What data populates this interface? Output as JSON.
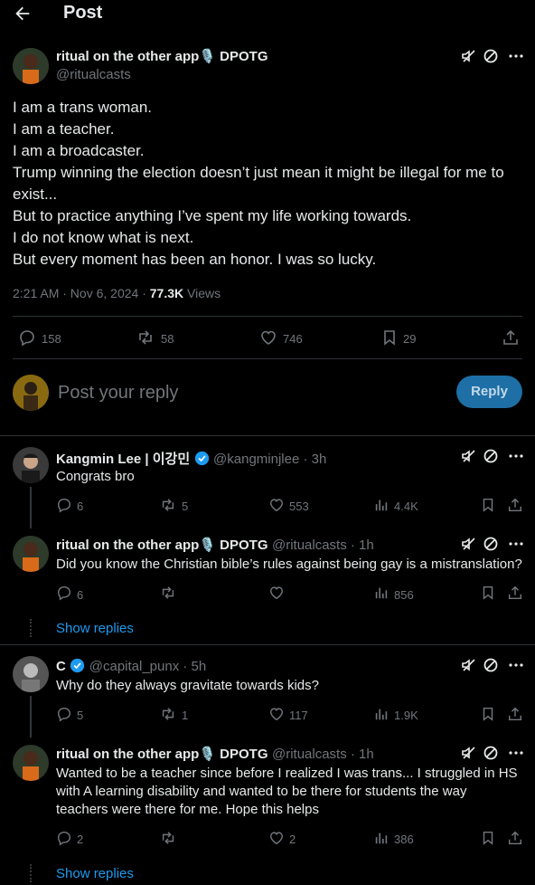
{
  "header": {
    "title": "Post"
  },
  "main_post": {
    "display_name": "ritual on the other app🎙️ DPOTG",
    "handle": "@ritualcasts",
    "lines": [
      "I am a trans woman.",
      "I am a teacher.",
      "I am a broadcaster.",
      "Trump winning the election doesn’t just mean it might be illegal for me to exist...",
      "But to practice anything I’ve spent my life working towards.",
      "I do not know what is next.",
      "But every moment has been an honor. I was so lucky."
    ],
    "timestamp": "2:21 AM · Nov 6, 2024 · ",
    "views_count": "77.3K",
    "views_label": " Views",
    "stats": {
      "replies": "158",
      "reposts": "58",
      "likes": "746",
      "bookmarks": "29"
    }
  },
  "compose": {
    "placeholder": "Post your reply",
    "reply_label": "Reply"
  },
  "replies": [
    {
      "display_name": "Kangmin Lee | 이강민",
      "handle": "@kangminjlee · 3h",
      "text": "Congrats bro",
      "stats": {
        "replies": "6",
        "reposts": "5",
        "likes": "553",
        "views": "4.4K"
      }
    },
    {
      "display_name": "ritual on the other app🎙️ DPOTG",
      "handle": "@ritualcasts · 1h",
      "text": "Did you know the Christian bible’s rules against being gay  is a mistranslation?",
      "stats": {
        "replies": "6",
        "reposts": "",
        "likes": "",
        "views": "856"
      }
    },
    {
      "display_name": "C",
      "handle": "@capital_punx · 5h",
      "text": "Why do they always gravitate towards kids?",
      "stats": {
        "replies": "5",
        "reposts": "1",
        "likes": "117",
        "views": "1.9K"
      }
    },
    {
      "display_name": "ritual on the other app🎙️ DPOTG",
      "handle": "@ritualcasts · 1h",
      "text_lines": [
        "Wanted to be a teacher since before I realized I was trans... I struggled in HS",
        "with A learning disability and wanted to be there for students the way",
        "teachers were there for me. Hope this helps"
      ],
      "stats": {
        "replies": "2",
        "reposts": "",
        "likes": "2",
        "views": "386"
      }
    }
  ],
  "show_replies_label": "Show replies",
  "colors": {
    "accent": "#1d9bf0",
    "reply_button_bg": "#1d6fa5",
    "muted": "#71767b"
  }
}
